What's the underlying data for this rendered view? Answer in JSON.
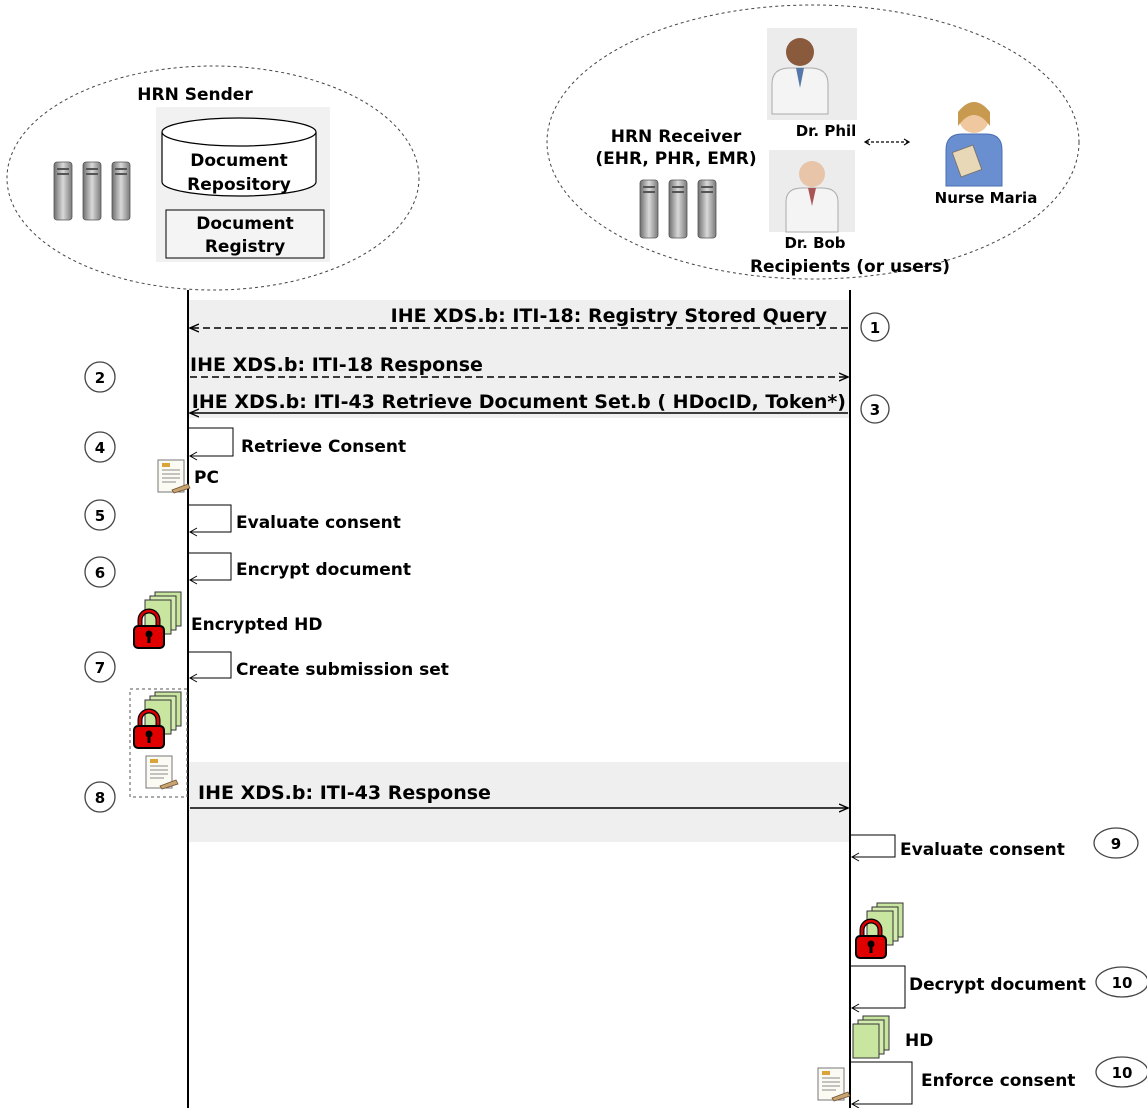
{
  "colors": {
    "band": "#efefef",
    "lock_red": "#e00000",
    "doc_green": "#c8e6a0",
    "server_gray": "#8c8c8c"
  },
  "sender": {
    "title": "HRN Sender",
    "repository_label_1": "Document",
    "repository_label_2": "Repository",
    "registry_label_1": "Document",
    "registry_label_2": "Registry",
    "icon": "server-icon"
  },
  "receiver": {
    "title_1": "HRN Receiver",
    "title_2": "(EHR, PHR, EMR)",
    "dr_phil": "Dr. Phil",
    "dr_bob": "Dr. Bob",
    "nurse_maria": "Nurse Maria",
    "recipients": "Recipients (or users)",
    "icon": "server-icon"
  },
  "messages": [
    {
      "number": "1",
      "label": "IHE XDS.b: ITI-18: Registry Stored Query",
      "style": "dashed",
      "direction": "to-sender"
    },
    {
      "number": "2",
      "label": "IHE XDS.b: ITI-18 Response",
      "style": "dashed",
      "direction": "to-receiver"
    },
    {
      "number": "3",
      "label": "IHE XDS.b: ITI-43 Retrieve Document Set.b ( HDocID, Token*)",
      "style": "solid",
      "direction": "to-sender"
    },
    {
      "number": "8",
      "label": "IHE XDS.b: ITI-43 Response",
      "style": "solid",
      "direction": "to-receiver"
    }
  ],
  "sender_steps": [
    {
      "number": "4",
      "label": "Retrieve Consent"
    },
    {
      "number": "5",
      "label": "Evaluate consent"
    },
    {
      "number": "6",
      "label": "Encrypt document"
    },
    {
      "number": "7",
      "label": "Create submission set"
    }
  ],
  "receiver_steps": [
    {
      "number": "9",
      "label": "Evaluate consent"
    },
    {
      "number": "10",
      "label": "Decrypt document"
    },
    {
      "number": "10",
      "label": "Enforce consent"
    }
  ],
  "artifacts": {
    "policy_consent": "PC",
    "encrypted_hd": "Encrypted HD",
    "hd": "HD"
  }
}
